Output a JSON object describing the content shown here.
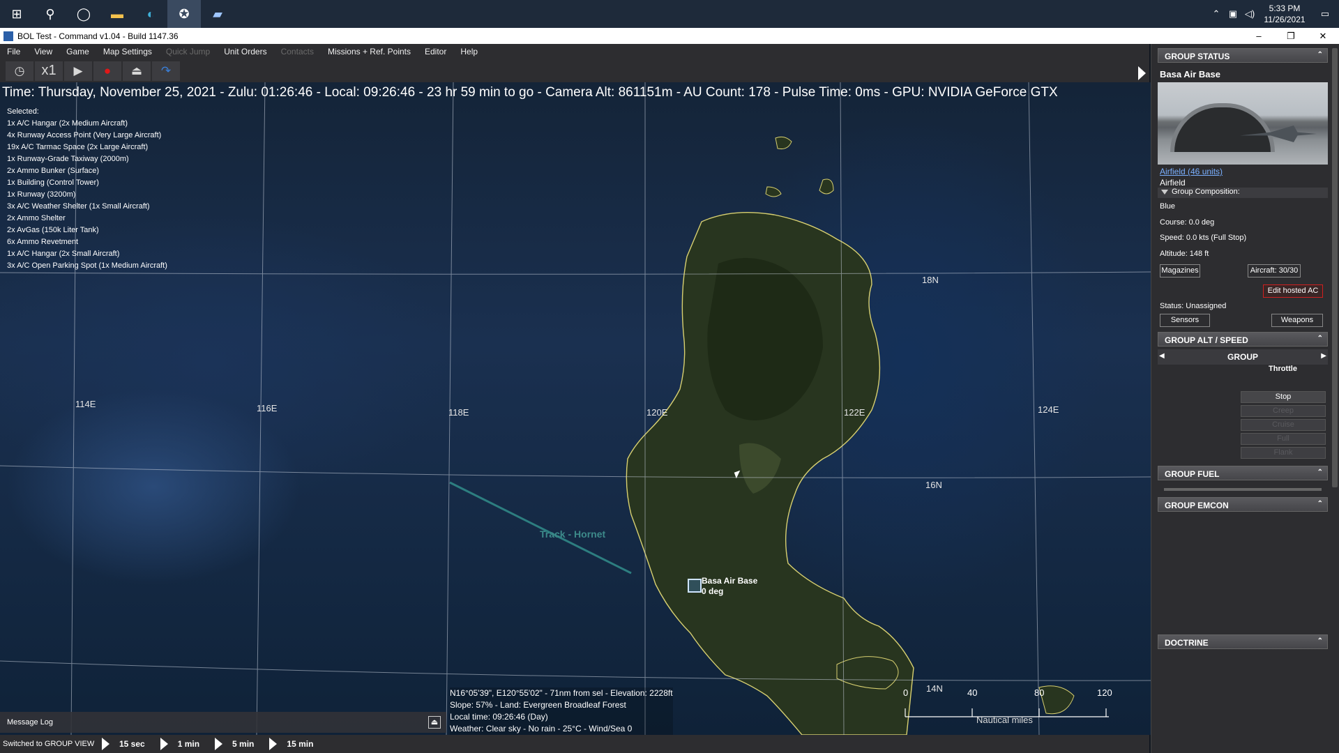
{
  "taskbar": {
    "icons": [
      "windows-start",
      "search",
      "cortana",
      "file-explorer",
      "edge",
      "command-app",
      "notepad"
    ],
    "clock_time": "5:33 PM",
    "clock_date": "11/26/2021"
  },
  "window": {
    "title": "BOL Test - Command v1.04 - Build 1147.36",
    "min": "–",
    "max": "❐",
    "close": "✕"
  },
  "menu": [
    "File",
    "View",
    "Game",
    "Map Settings",
    "Quick Jump",
    "Unit Orders",
    "Contacts",
    "Missions + Ref. Points",
    "Editor",
    "Help"
  ],
  "toolbar": {
    "speed": "x1"
  },
  "map": {
    "status_line": "Time: Thursday, November 25, 2021 - Zulu: 01:26:46 - Local: 09:26:46 - 23 hr 59 min to go -  Camera Alt: 861151m  - AU Count: 178 - Pulse Time: 0ms - GPU: NVIDIA GeForce GTX",
    "selected_header": "Selected:",
    "selected_items": [
      "1x A/C Hangar (2x Medium Aircraft)",
      "4x Runway Access Point (Very Large Aircraft)",
      "19x A/C Tarmac Space (2x Large Aircraft)",
      "1x Runway-Grade Taxiway (2000m)",
      "2x Ammo Bunker (Surface)",
      "1x Building (Control Tower)",
      "1x Runway (3200m)",
      "3x A/C Weather Shelter (1x Small Aircraft)",
      "2x Ammo Shelter",
      "2x AvGas (150k Liter Tank)",
      "6x Ammo Revetment",
      "1x A/C Hangar (2x Small Aircraft)",
      "3x A/C Open Parking Spot (1x Medium Aircraft)"
    ],
    "lon_labels": [
      "114E",
      "116E",
      "118E",
      "120E",
      "122E",
      "124E"
    ],
    "lat_labels": [
      "18N",
      "16N",
      "14N"
    ],
    "track_label": "Track - Hornet",
    "base_name": "Basa Air Base",
    "base_heading": "0 deg",
    "cursor_info": [
      "N16°05'39\", E120°55'02\" - 71nm from sel - Elevation: 2228ft",
      "Slope: 57% - Land: Evergreen Broadleaf Forest",
      "Local time: 09:26:46 (Day)",
      "Weather: Clear sky - No rain - 25°C - Wind/Sea 0"
    ],
    "scale_numbers": [
      "0",
      "40",
      "80",
      "120"
    ],
    "scale_units": "Nautical miles"
  },
  "message_log": {
    "label": "Message Log",
    "btn": "⏏"
  },
  "bottombar": {
    "status": "Switched to GROUP VIEW",
    "steps": [
      "15 sec",
      "1 min",
      "5 min",
      "15 min"
    ]
  },
  "panel": {
    "group_status": "GROUP STATUS",
    "unit_name": "Basa Air Base",
    "link": "Airfield (46 units)",
    "type": "Airfield",
    "group_composition": "Group Composition:",
    "side": "Blue",
    "course": "Course: 0.0 deg",
    "speed": "Speed: 0.0 kts (Full Stop)",
    "altitude": "Altitude: 148 ft",
    "magazines": "Magazines",
    "aircraft": "Aircraft: 30/30",
    "edit_hosted": "Edit hosted AC",
    "status": "Status: Unassigned",
    "sensors": "Sensors",
    "weapons": "Weapons",
    "alt_speed": "GROUP ALT / SPEED",
    "alt_group": "GROUP",
    "throttle": "Throttle",
    "throttle_options": [
      "Stop",
      "Creep",
      "Cruise",
      "Full",
      "Flank"
    ],
    "fuel": "GROUP FUEL",
    "emcon": "GROUP EMCON",
    "doctrine": "DOCTRINE",
    "collapse": "⌃"
  }
}
